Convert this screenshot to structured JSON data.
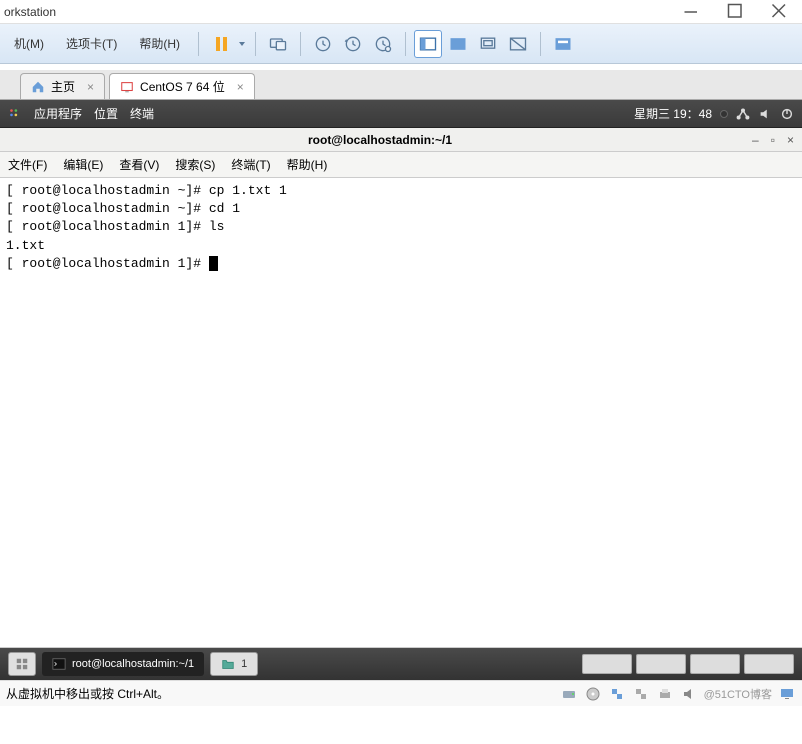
{
  "window": {
    "title_fragment": "orkstation"
  },
  "menubar": {
    "items": [
      "机(M)",
      "选项卡(T)",
      "帮助(H)"
    ]
  },
  "tabs": {
    "home": "主页",
    "vm": "CentOS 7 64 位"
  },
  "guest_menu": {
    "apps": "应用程序",
    "places": "位置",
    "terminal": "终端",
    "clock": "星期三 19：48"
  },
  "terminal": {
    "title": "root@localhostadmin:~/1",
    "menu": [
      "文件(F)",
      "编辑(E)",
      "查看(V)",
      "搜索(S)",
      "终端(T)",
      "帮助(H)"
    ],
    "lines": [
      "[ root@localhostadmin ~]# cp 1.txt 1",
      "[ root@localhostadmin ~]# cd 1",
      "[ root@localhostadmin 1]# ls",
      "1.txt",
      "[ root@localhostadmin 1]# "
    ]
  },
  "taskbar": {
    "term_task": "root@localhostadmin:~/1",
    "folder_task": "1"
  },
  "statusbar": {
    "hint": "从虚拟机中移出或按 Ctrl+Alt。",
    "watermark": "@51CTO博客"
  }
}
